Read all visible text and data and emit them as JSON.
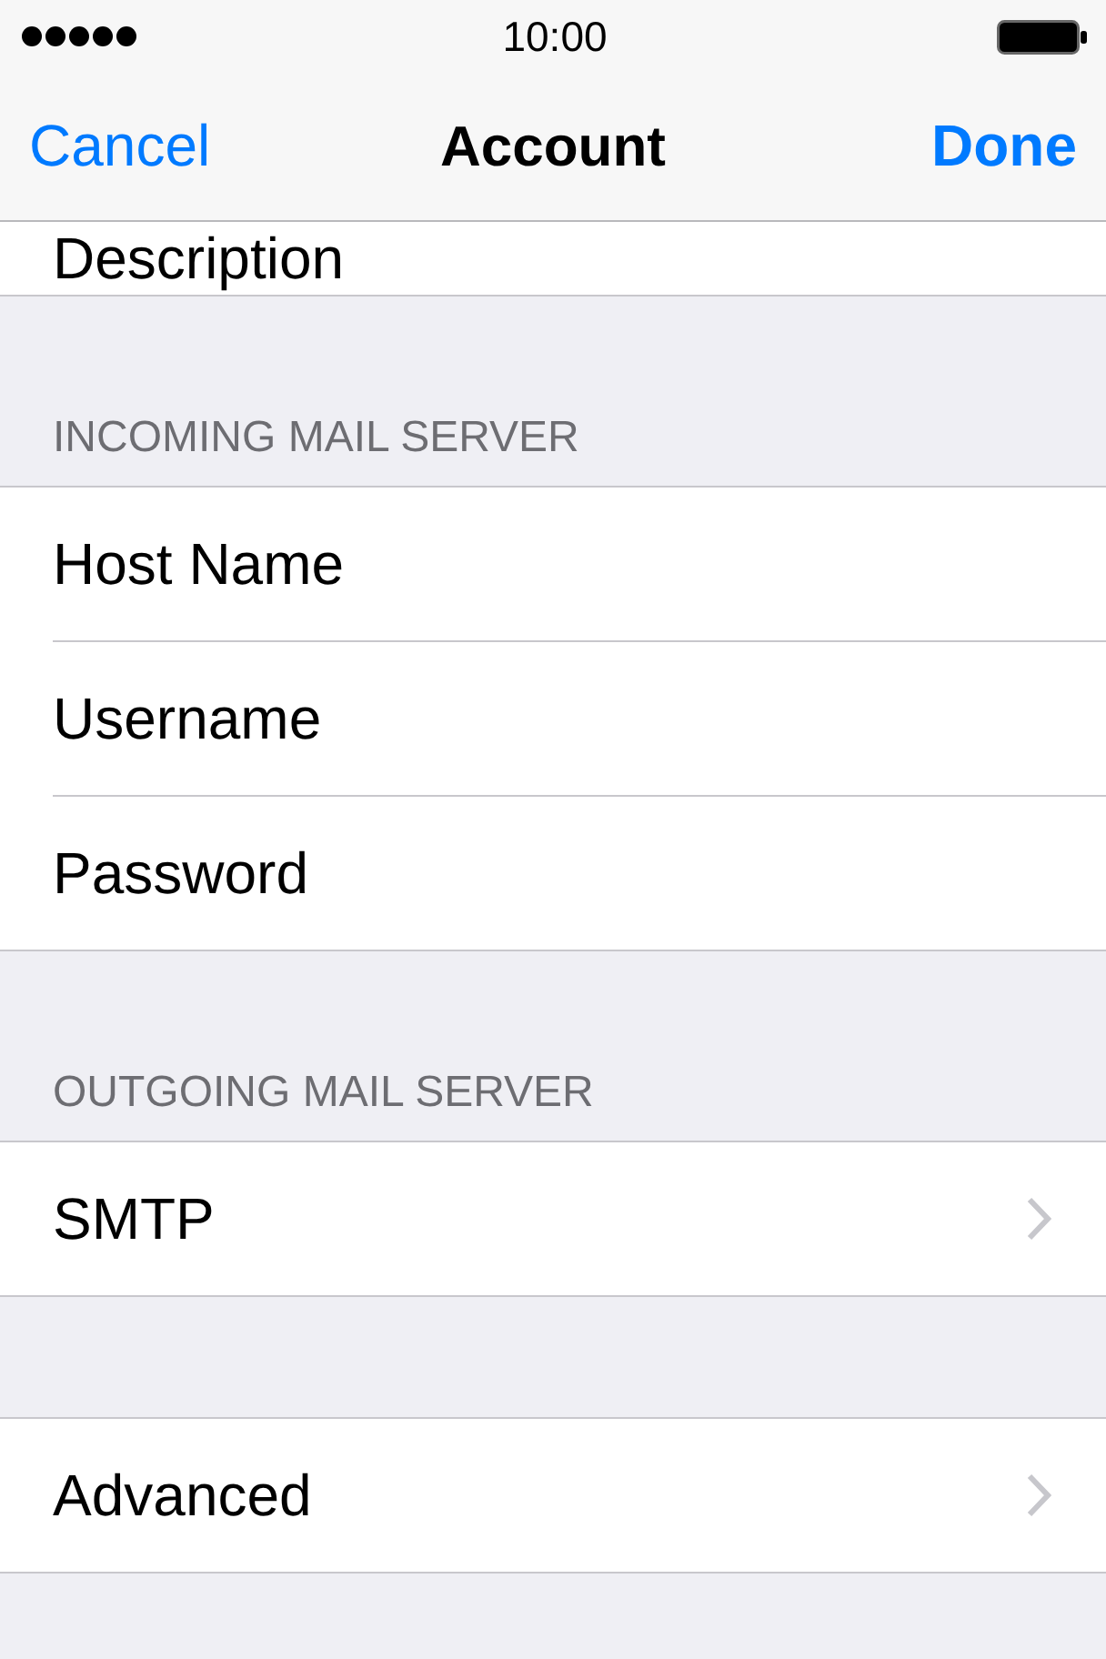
{
  "status_bar": {
    "time": "10:00"
  },
  "nav_bar": {
    "cancel_button": "Cancel",
    "title": "Account",
    "done_button": "Done"
  },
  "sections": [
    {
      "rows": [
        {
          "kind": "field",
          "label": "Description"
        }
      ]
    },
    {
      "header": "INCOMING MAIL SERVER",
      "rows": [
        {
          "kind": "field",
          "label": "Host Name"
        },
        {
          "kind": "field",
          "label": "Username"
        },
        {
          "kind": "field",
          "label": "Password"
        }
      ]
    },
    {
      "header": "OUTGOING MAIL SERVER",
      "rows": [
        {
          "kind": "disclosure",
          "label": "SMTP"
        }
      ]
    },
    {
      "rows": [
        {
          "kind": "disclosure",
          "label": "Advanced"
        }
      ]
    }
  ]
}
